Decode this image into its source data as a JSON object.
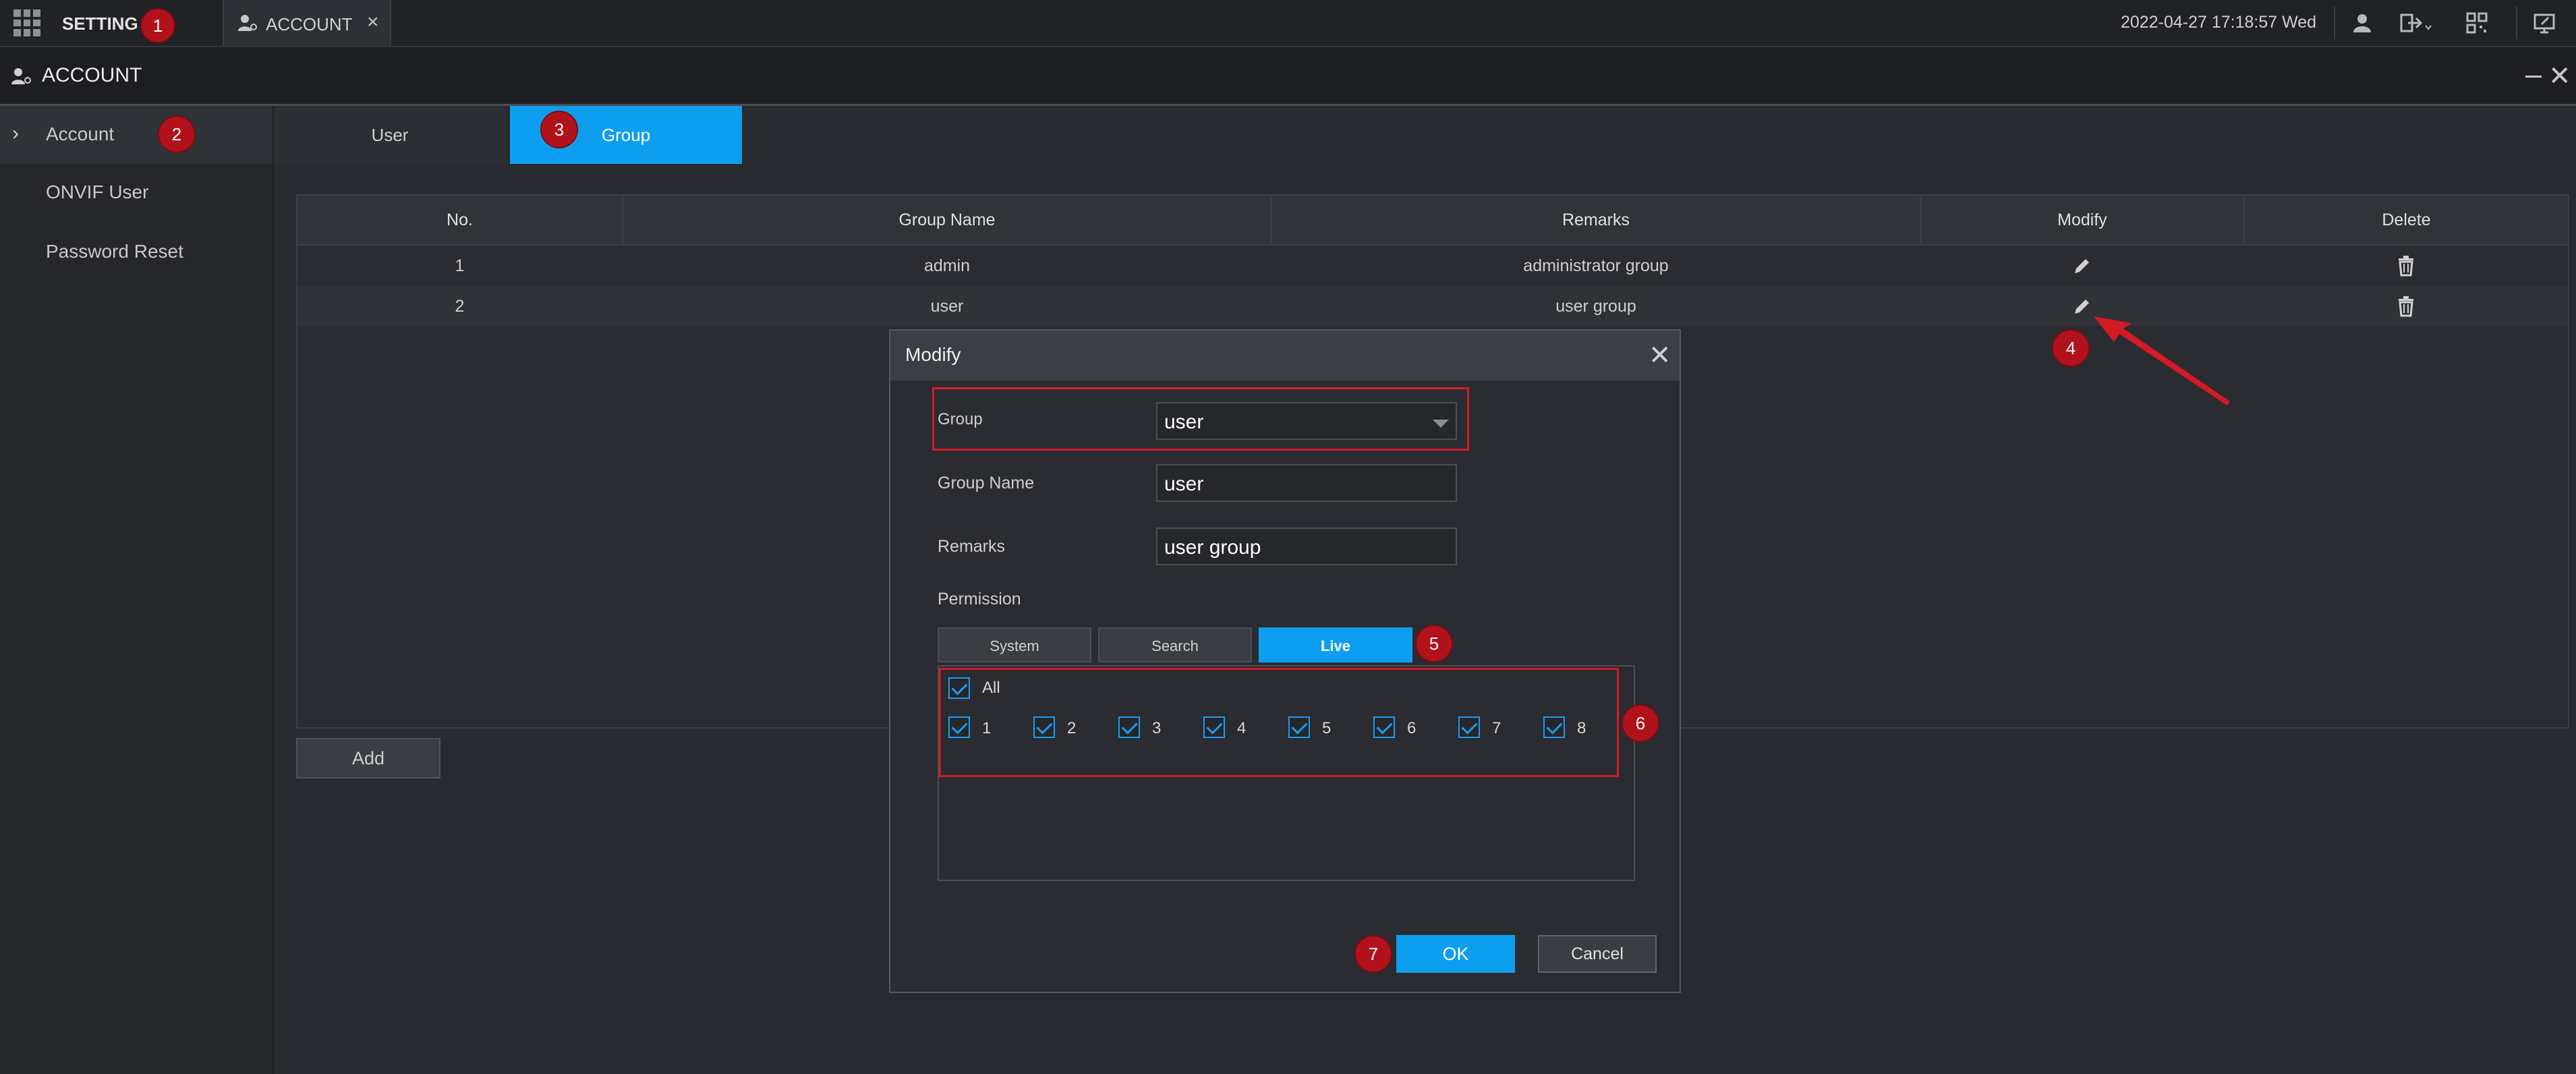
{
  "topbar": {
    "setting_label": "SETTING",
    "tab_label": "ACCOUNT",
    "tab_close": "×",
    "datetime": "2022-04-27 17:18:57 Wed"
  },
  "header": {
    "title": "ACCOUNT",
    "close": "✕"
  },
  "sidebar": {
    "items": [
      {
        "label": "Account",
        "active": true
      },
      {
        "label": "ONVIF User",
        "active": false
      },
      {
        "label": "Password Reset",
        "active": false
      }
    ],
    "chevron": "›"
  },
  "content_tabs": [
    {
      "label": "User",
      "active": false
    },
    {
      "label": "Group",
      "active": true
    }
  ],
  "table": {
    "headers": [
      "No.",
      "Group Name",
      "Remarks",
      "Modify",
      "Delete"
    ],
    "rows": [
      {
        "no": "1",
        "name": "admin",
        "remarks": "administrator group"
      },
      {
        "no": "2",
        "name": "user",
        "remarks": "user group"
      }
    ]
  },
  "add_button": "Add",
  "dialog": {
    "title": "Modify",
    "close": "✕",
    "group_label": "Group",
    "group_value": "user",
    "group_name_label": "Group Name",
    "group_name_value": "user",
    "remarks_label": "Remarks",
    "remarks_value": "user group",
    "permission_label": "Permission",
    "perm_tabs": [
      {
        "label": "System",
        "active": false
      },
      {
        "label": "Search",
        "active": false
      },
      {
        "label": "Live",
        "active": true
      }
    ],
    "all_label": "All",
    "channels": [
      "1",
      "2",
      "3",
      "4",
      "5",
      "6",
      "7",
      "8"
    ],
    "ok": "OK",
    "cancel": "Cancel"
  },
  "annotations": [
    "1",
    "2",
    "3",
    "4",
    "5",
    "6",
    "7"
  ],
  "colors": {
    "accent": "#0e9ef0",
    "highlight": "#d41a24",
    "badge": "#b2121c"
  },
  "icons": [
    "apps-grid-icon",
    "account-icon",
    "user-icon",
    "logout-icon",
    "qr-code-icon",
    "monitor-icon",
    "edit-icon",
    "trash-icon"
  ]
}
